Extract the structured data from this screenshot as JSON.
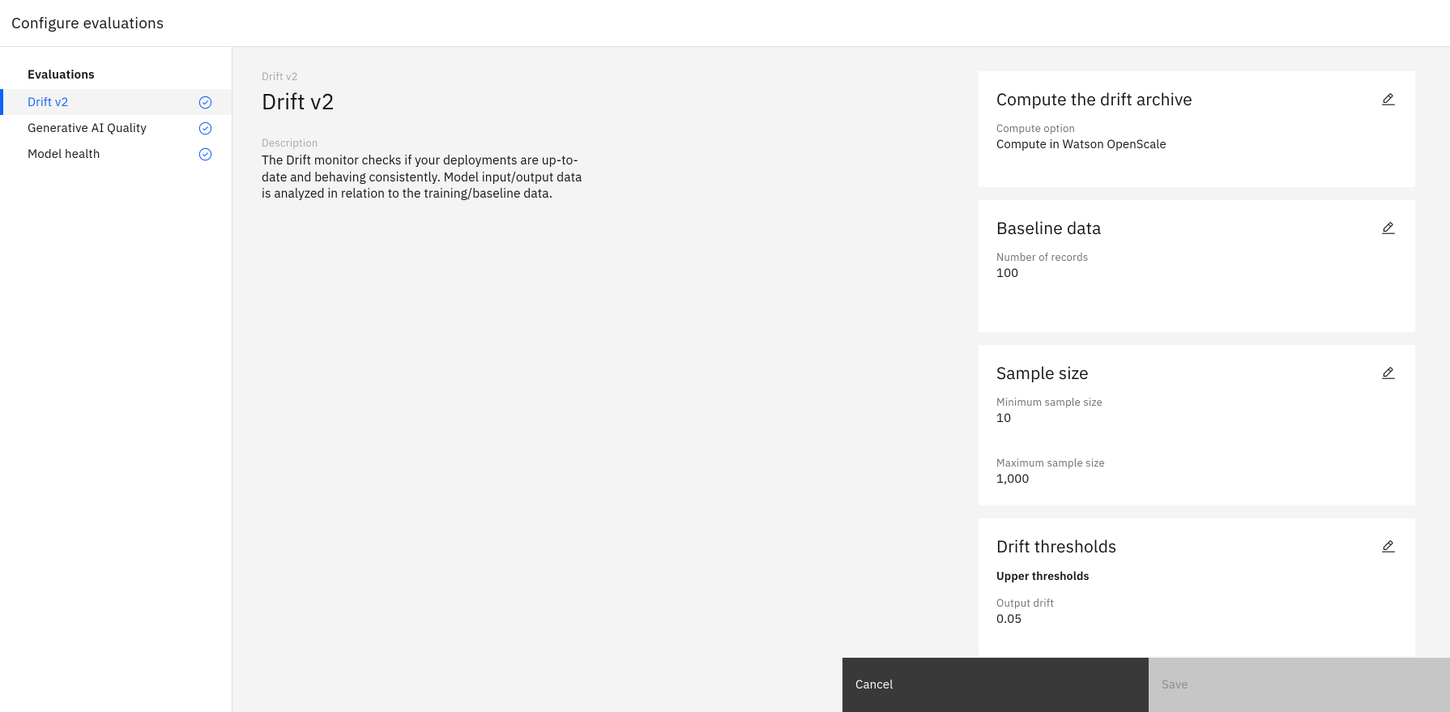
{
  "header": {
    "title": "Configure evaluations"
  },
  "sidebar": {
    "heading": "Evaluations",
    "items": [
      {
        "label": "Drift v2",
        "icon": "checkmark-outline-icon",
        "active": true
      },
      {
        "label": "Generative AI Quality",
        "icon": "checkmark-outline-icon",
        "active": false
      },
      {
        "label": "Model health",
        "icon": "checkmark-outline-icon",
        "active": false
      }
    ]
  },
  "main": {
    "eyebrow": "Drift v2",
    "title": "Drift v2",
    "description_label": "Description",
    "description": "The Drift monitor checks if your deployments are up-to-date and behaving consistently. Model input/output data is analyzed in relation to the training/baseline data."
  },
  "panel": {
    "cards": [
      {
        "title": "Compute the drift archive",
        "edit_icon": "edit-pencil-icon",
        "fields": [
          {
            "label": "Compute option",
            "value": "Compute in Watson OpenScale"
          }
        ]
      },
      {
        "title": "Baseline data",
        "edit_icon": "edit-pencil-icon",
        "fields": [
          {
            "label": "Number of records",
            "value": "100"
          }
        ]
      },
      {
        "title": "Sample size",
        "edit_icon": "edit-pencil-icon",
        "fields": [
          {
            "label": "Minimum sample size",
            "value": "10"
          },
          {
            "label": "Maximum sample size",
            "value": "1,000"
          }
        ]
      },
      {
        "title": "Drift thresholds",
        "edit_icon": "edit-pencil-icon",
        "subhead": "Upper thresholds",
        "fields": [
          {
            "label": "Output drift",
            "value": "0.05"
          }
        ]
      }
    ]
  },
  "actions": {
    "cancel_label": "Cancel",
    "save_label": "Save",
    "save_disabled": true
  },
  "colors": {
    "accent": "#0f62fe",
    "page_bg": "#f4f4f4",
    "card_bg": "#ffffff",
    "cancel_bg": "#393939",
    "save_bg": "#c6c6c6",
    "save_text": "#8d8d8d",
    "muted_text": "#a8a8a8",
    "label_text": "#6f6f6f",
    "primary_text": "#161616"
  }
}
